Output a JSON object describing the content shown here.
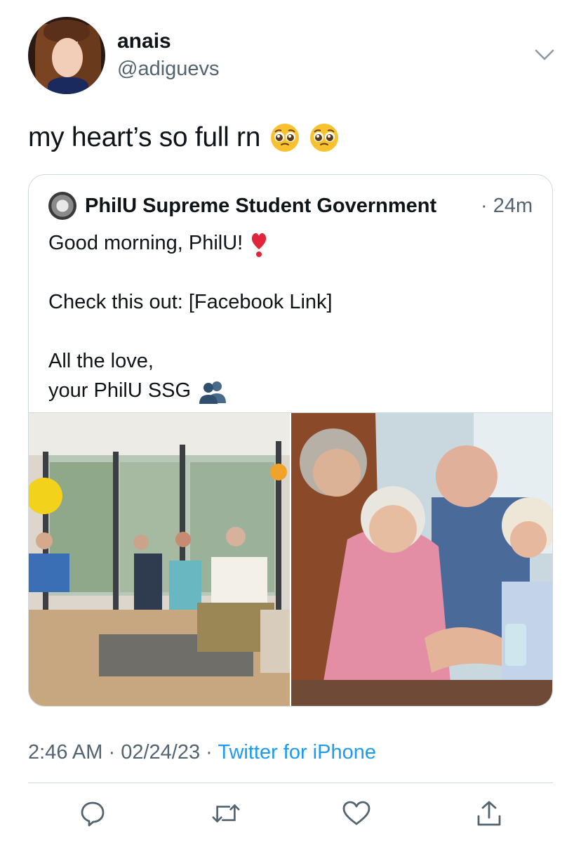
{
  "author": {
    "display_name": "anais",
    "handle": "@adiguevs"
  },
  "tweet": {
    "text": "my heart’s so full rn",
    "emojis": [
      "pleading-face",
      "pleading-face"
    ]
  },
  "quoted_tweet": {
    "author_name": "PhilU Supreme Student Government",
    "time_ago": "· 24m",
    "lines": [
      "Good morning, PhilU!",
      "Check this out: [Facebook Link]",
      "All the love,",
      "your PhilU SSG"
    ],
    "emojis": [
      "heavy-heart-exclamation",
      "busts-in-silhouette"
    ]
  },
  "meta": {
    "time": "2:46 AM",
    "sep1": " · ",
    "date": "02/24/23",
    "sep2": " · ",
    "source": "Twitter for iPhone"
  },
  "actions": [
    "reply-icon",
    "retweet-icon",
    "like-icon",
    "share-icon"
  ],
  "colors": {
    "accent": "#1d9bf0",
    "secondary_text": "#536471",
    "border": "#cfd9de"
  }
}
